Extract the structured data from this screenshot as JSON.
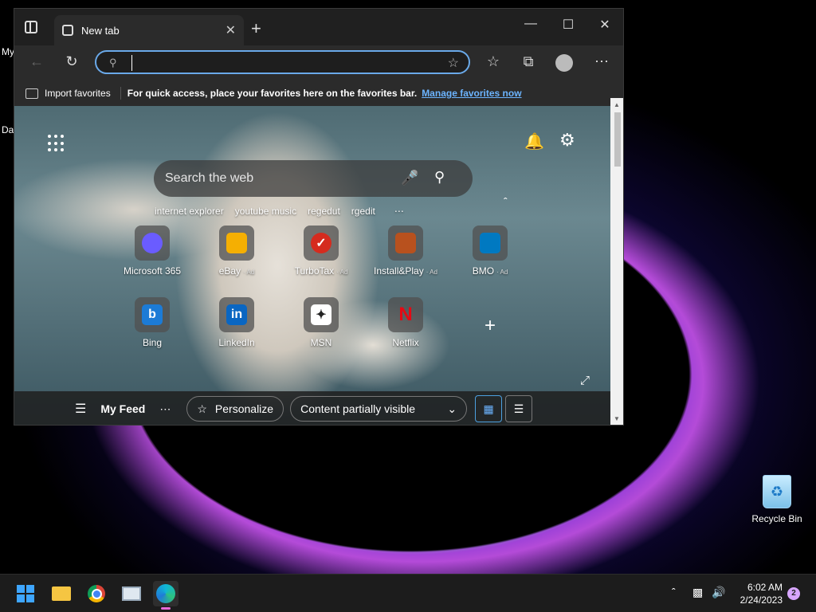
{
  "desktop": {
    "partial_labels": [
      "My",
      "Da"
    ],
    "recycle_bin_label": "Recycle Bin"
  },
  "browser": {
    "tab": {
      "title": "New tab"
    },
    "address_bar": {
      "value": "",
      "placeholder": ""
    },
    "favorites_bar": {
      "import_label": "Import favorites",
      "hint": "For quick access, place your favorites here on the favorites bar.",
      "manage_link": "Manage favorites now"
    },
    "new_tab_page": {
      "search_placeholder": "Search the web",
      "recent_searches": [
        "internet explorer",
        "youtube music",
        "regedut",
        "rgedit"
      ],
      "tiles": [
        {
          "name": "Microsoft 365",
          "ad": "",
          "icon": "microsoft-365-icon",
          "color": "#6a5cff"
        },
        {
          "name": "eBay",
          "ad": "Ad",
          "icon": "ebay-bag-icon",
          "color": "#f5af02"
        },
        {
          "name": "TurboTax",
          "ad": "Ad",
          "icon": "turbotax-check-icon",
          "color": "#d52b1e"
        },
        {
          "name": "Install&Play",
          "ad": "Ad",
          "icon": "install-play-game-icon",
          "color": "#b8511e"
        },
        {
          "name": "BMO",
          "ad": "Ad",
          "icon": "bmo-logo-icon",
          "color": "#0079c1"
        },
        {
          "name": "Bing",
          "ad": "",
          "icon": "bing-icon",
          "color": "#1c7bd6"
        },
        {
          "name": "LinkedIn",
          "ad": "",
          "icon": "linkedin-icon",
          "color": "#0a66c2"
        },
        {
          "name": "MSN",
          "ad": "",
          "icon": "msn-icon",
          "color": "#222222"
        },
        {
          "name": "Netflix",
          "ad": "",
          "icon": "netflix-icon",
          "color": "#e50914"
        }
      ],
      "feed_bar": {
        "my_feed": "My Feed",
        "personalize": "Personalize",
        "visibility": "Content partially visible"
      }
    }
  },
  "taskbar": {
    "apps": [
      "start-icon",
      "file-explorer-icon",
      "chrome-icon",
      "monitor-app-icon",
      "edge-icon"
    ],
    "clock": {
      "time": "6:02 AM",
      "date": "2/24/2023"
    },
    "notifications_count": "2"
  }
}
